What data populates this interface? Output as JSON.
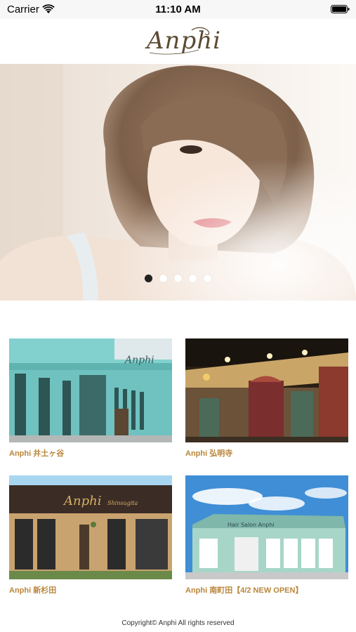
{
  "status_bar": {
    "carrier": "Carrier",
    "time": "11:10 AM"
  },
  "header": {
    "logo_text": "Anphi"
  },
  "carousel": {
    "pages": 5,
    "active_index": 0
  },
  "shops": [
    {
      "label": "Anphi 井土ヶ谷"
    },
    {
      "label": "Anphi 弘明寺"
    },
    {
      "label": "Anphi 新杉田"
    },
    {
      "label": "Anphi 南町田【4/2 NEW OPEN】"
    }
  ],
  "footer": {
    "copyright": "Copyright© Anphi All rights reserved"
  },
  "colors": {
    "accent": "#b8863a",
    "active_dot": "#222222"
  }
}
